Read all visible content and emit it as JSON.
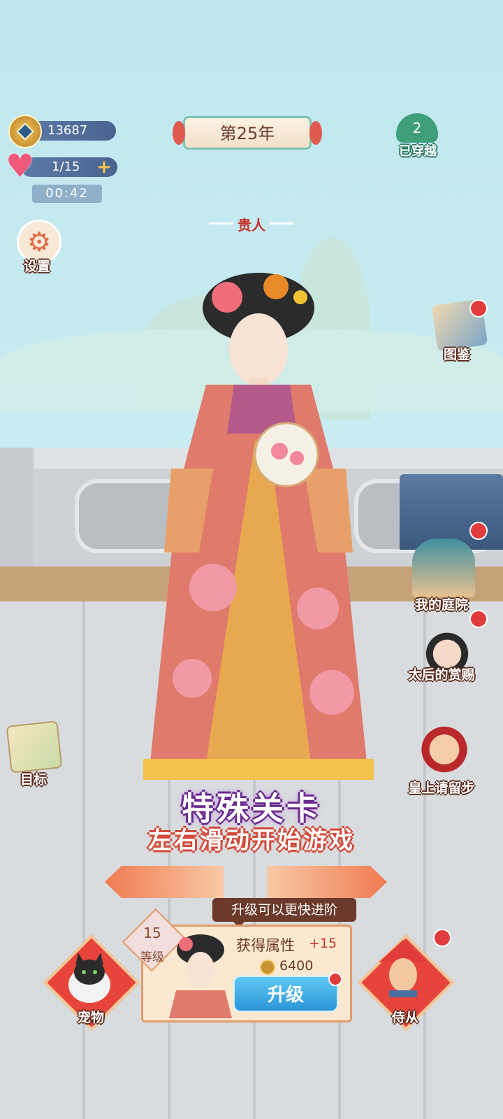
{
  "hud": {
    "coins": "13687",
    "stamina": "1/15",
    "stamina_plus": "+",
    "timer": "00:42",
    "year": "第25年",
    "crossed_count": "2",
    "crossed_label": "已穿越",
    "rank": "贵人",
    "settings_label": "设置"
  },
  "side_menu": {
    "gallery": "图鉴",
    "courtyard": "我的庭院",
    "empress_reward": "太后的赏赐",
    "emperor": "皇上请留步",
    "goal": "目标"
  },
  "stage": {
    "title": "特殊关卡",
    "subtitle": "左右滑动开始游戏"
  },
  "upgrade": {
    "tip": "升级可以更快进阶",
    "level": "15",
    "level_label": "等级",
    "attr_label": "获得属性",
    "attr_value": "+15",
    "cost": "6400",
    "button": "升级"
  },
  "bottom": {
    "pet": "宠物",
    "servant": "侍从"
  },
  "colors": {
    "accent_red": "#e23b3b",
    "button_blue": "#2a95d6",
    "coin_pill": "#4a6390"
  }
}
